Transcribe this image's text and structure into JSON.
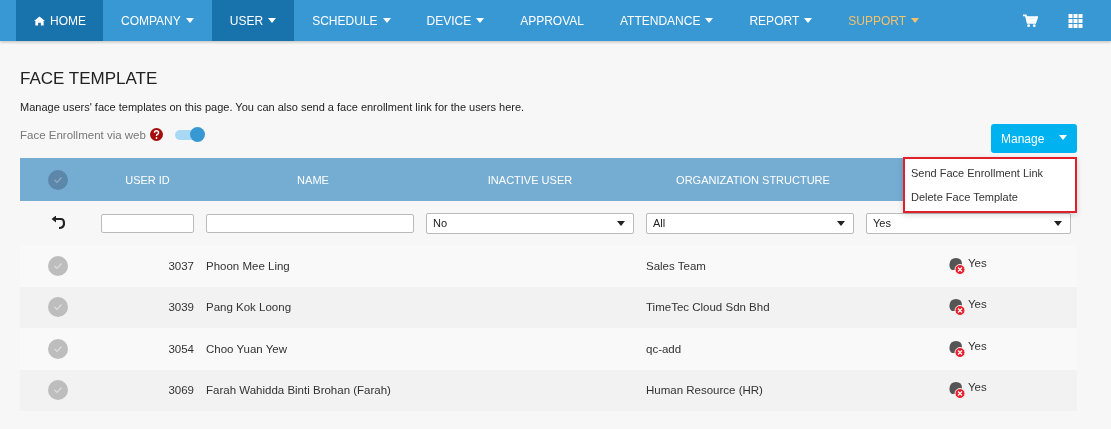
{
  "nav": {
    "items": [
      {
        "label": "HOME",
        "kind": "home",
        "selected": true,
        "caret": false,
        "highlighted": false
      },
      {
        "label": "COMPANY",
        "kind": "menu",
        "selected": false,
        "caret": true,
        "highlighted": false
      },
      {
        "label": "USER",
        "kind": "menu",
        "selected": true,
        "caret": true,
        "highlighted": false
      },
      {
        "label": "SCHEDULE",
        "kind": "menu",
        "selected": false,
        "caret": true,
        "highlighted": false
      },
      {
        "label": "DEVICE",
        "kind": "menu",
        "selected": false,
        "caret": true,
        "highlighted": false
      },
      {
        "label": "APPROVAL",
        "kind": "menu",
        "selected": false,
        "caret": false,
        "highlighted": false
      },
      {
        "label": "ATTENDANCE",
        "kind": "menu",
        "selected": false,
        "caret": true,
        "highlighted": false
      },
      {
        "label": "REPORT",
        "kind": "menu",
        "selected": false,
        "caret": true,
        "highlighted": false
      },
      {
        "label": "SUPPORT",
        "kind": "menu",
        "selected": false,
        "caret": true,
        "highlighted": true
      }
    ]
  },
  "page": {
    "title": "FACE TEMPLATE",
    "description": "Manage users' face templates on this page. You can also send a face enrollment link for the users here."
  },
  "enrollment_toggle": {
    "label": "Face Enrollment via web",
    "on": true
  },
  "manage": {
    "label": "Manage",
    "menu": [
      "Send Face Enrollment Link",
      "Delete Face Template"
    ]
  },
  "table": {
    "all_selected": false,
    "columns": [
      "USER ID",
      "NAME",
      "INACTIVE USER",
      "ORGANIZATION STRUCTURE"
    ],
    "filters": {
      "inactive_user": "No",
      "organization_structure": "All",
      "column_6": "Yes"
    },
    "rows": [
      {
        "user_id": "3037",
        "name": "Phoon Mee Ling",
        "organization": "Sales Team",
        "face": "Yes",
        "selected": false
      },
      {
        "user_id": "3039",
        "name": "Pang Kok Loong",
        "organization": "TimeTec Cloud Sdn Bhd",
        "face": "Yes",
        "selected": false
      },
      {
        "user_id": "3054",
        "name": "Choo Yuan Yew",
        "organization": "qc-add",
        "face": "Yes",
        "selected": false
      },
      {
        "user_id": "3069",
        "name": "Farah Wahidda Binti Brohan (Farah)",
        "organization": "Human Resource (HR)",
        "face": "Yes",
        "selected": false
      }
    ]
  }
}
